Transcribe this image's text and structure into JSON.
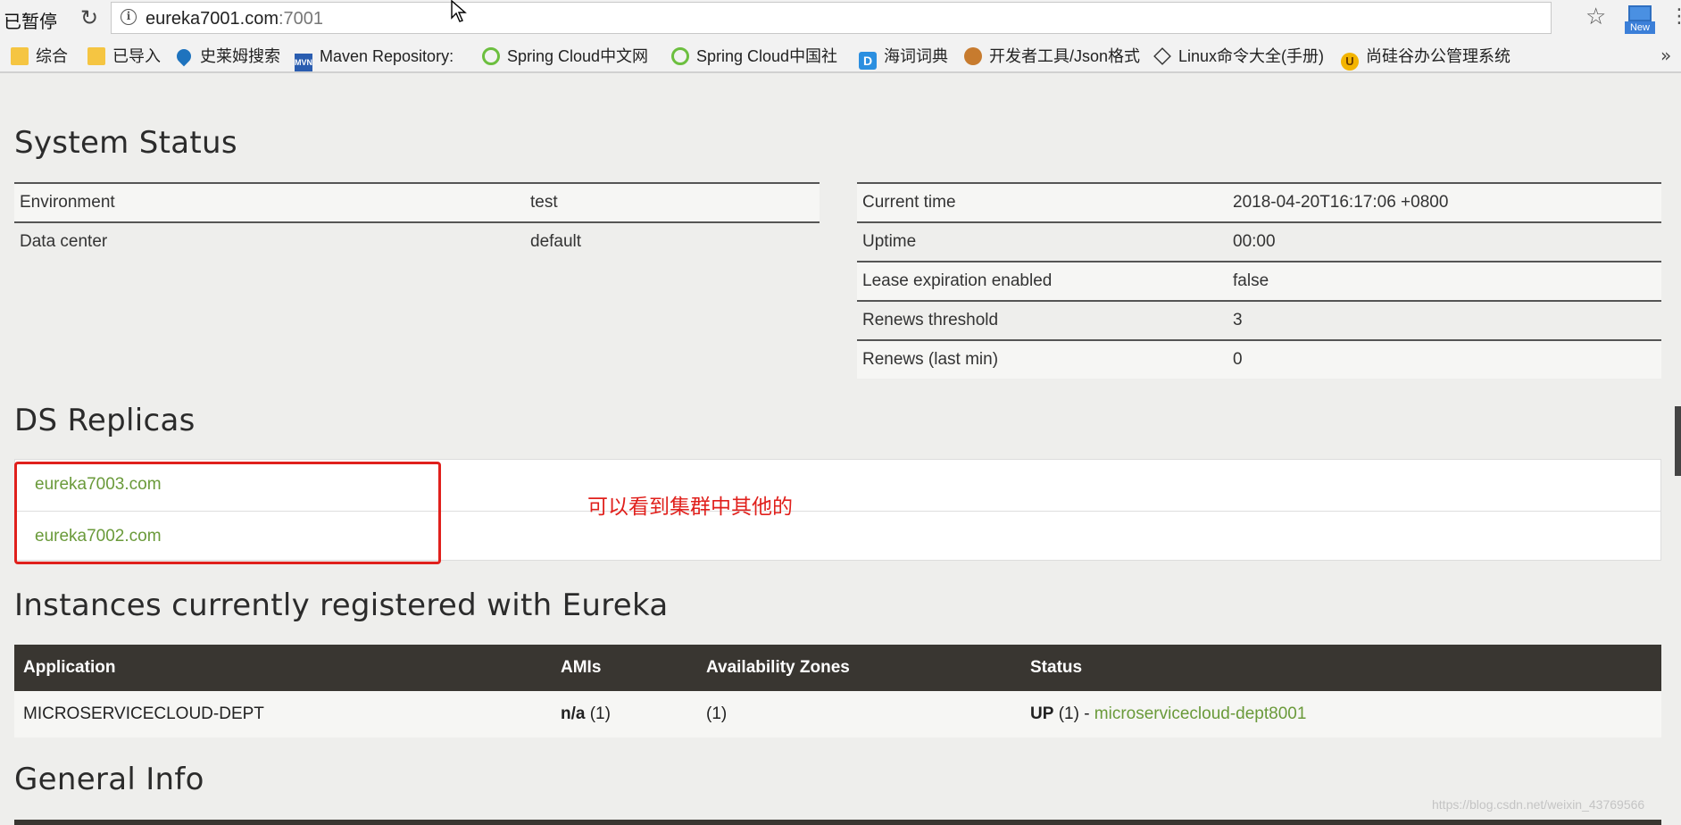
{
  "browser": {
    "pause_label": "已暂停",
    "url_host": "eureka7001.com",
    "url_port": ":7001",
    "ext_label": "New",
    "bookmarks": [
      {
        "label": "综合",
        "icon": "folder-icon"
      },
      {
        "label": "已导入",
        "icon": "folder-icon"
      },
      {
        "label": "史莱姆搜索",
        "icon": "search-drop-icon"
      },
      {
        "label": "Maven Repository:",
        "icon": "maven-icon"
      },
      {
        "label": "Spring Cloud中文网",
        "icon": "spring-cloud-icon"
      },
      {
        "label": "Spring Cloud中国社",
        "icon": "spring-cloud-icon"
      },
      {
        "label": "海词词典",
        "icon": "dict-icon"
      },
      {
        "label": "开发者工具/Json格式",
        "icon": "monkey-icon"
      },
      {
        "label": "Linux命令大全(手册)",
        "icon": "linux-icon"
      },
      {
        "label": "尚硅谷办公管理系统",
        "icon": "atguigu-icon"
      }
    ],
    "more": "»"
  },
  "system_status": {
    "title": "System Status",
    "left": [
      {
        "key": "Environment",
        "value": "test"
      },
      {
        "key": "Data center",
        "value": "default"
      }
    ],
    "right": [
      {
        "key": "Current time",
        "value": "2018-04-20T16:17:06 +0800"
      },
      {
        "key": "Uptime",
        "value": "00:00"
      },
      {
        "key": "Lease expiration enabled",
        "value": "false"
      },
      {
        "key": "Renews threshold",
        "value": "3"
      },
      {
        "key": "Renews (last min)",
        "value": "0"
      }
    ]
  },
  "ds_replicas": {
    "title": "DS Replicas",
    "items": [
      "eureka7003.com",
      "eureka7002.com"
    ],
    "note": "可以看到集群中其他的"
  },
  "instances": {
    "title": "Instances currently registered with Eureka",
    "headers": [
      "Application",
      "AMIs",
      "Availability Zones",
      "Status"
    ],
    "rows": [
      {
        "application": "MICROSERVICECLOUD-DEPT",
        "amis_main": "n/a",
        "amis_count": "(1)",
        "zones": "(1)",
        "status_main": "UP",
        "status_count": "(1) -",
        "status_link": "microservicecloud-dept8001"
      }
    ]
  },
  "general_info": {
    "title": "General Info"
  },
  "watermark": "https://blog.csdn.net/weixin_43769566"
}
